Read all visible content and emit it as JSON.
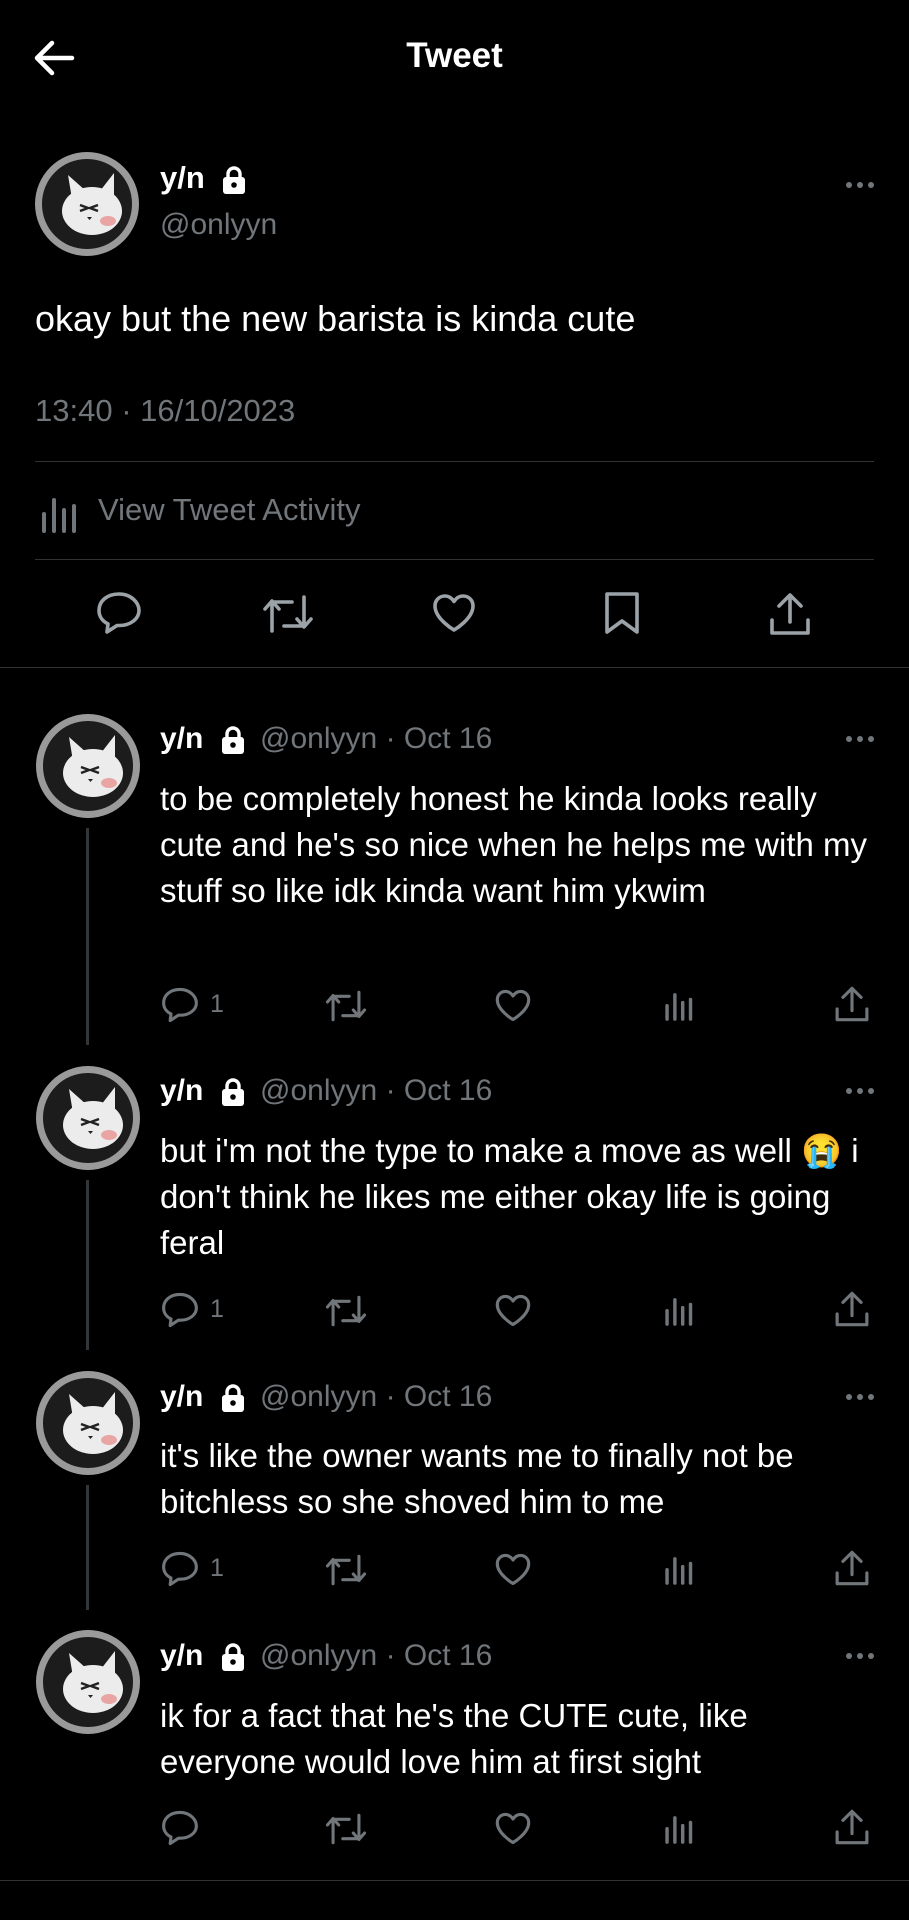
{
  "header": {
    "title": "Tweet",
    "back_icon": "arrow-left-icon"
  },
  "main_tweet": {
    "name": "y/n",
    "handle": "@onlyyn",
    "text": "okay but the new barista is kinda cute",
    "timestamp": "13:40 · 16/10/2023",
    "activity_label": "View Tweet Activity"
  },
  "replies": [
    {
      "name": "y/n",
      "handle": "@onlyyn",
      "sep": "·",
      "date": "Oct 16",
      "text": "to be completely honest he kinda looks really cute and he's so nice when he helps me with my stuff so like idk kinda want him ykwim",
      "reply_count": "1"
    },
    {
      "name": "y/n",
      "handle": "@onlyyn",
      "sep": "·",
      "date": "Oct 16",
      "text_pre": "but i'm not the type to make a move as well ",
      "emoji": "😭",
      "text_post": " i don't think he likes me either okay life is going feral",
      "reply_count": "1"
    },
    {
      "name": "y/n",
      "handle": "@onlyyn",
      "sep": "·",
      "date": "Oct 16",
      "text": "it's like the owner wants me to finally not be bitchless so she shoved him to me",
      "reply_count": "1"
    },
    {
      "name": "y/n",
      "handle": "@onlyyn",
      "sep": "·",
      "date": "Oct 16",
      "text": "ik for a fact that he's the CUTE cute, like everyone would love him at first sight",
      "reply_count": ""
    }
  ],
  "colors": {
    "background": "#000000",
    "text": "#e7e9ea",
    "muted": "#71767b",
    "divider": "#2f3336"
  }
}
